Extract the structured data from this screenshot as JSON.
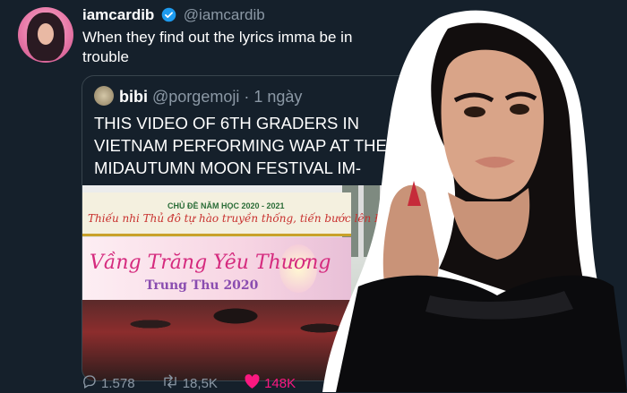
{
  "tweet": {
    "display_name": "iamcardib",
    "handle": "@iamcardib",
    "text": "When they find out the lyrics imma be in trouble"
  },
  "quoted_tweet": {
    "display_name": "bibi",
    "handle": "@porgemoji",
    "time": "· 1 ngày",
    "text": "THIS VIDEO OF 6TH GRADERS IN VIETNAM PERFORMING WAP AT THEIR MIDAUTUMN MOON FESTIVAL IM-"
  },
  "video_banner": {
    "topic": "CHỦ ĐỀ NĂM HỌC 2020 - 2021",
    "slogan": "Thiếu nhi Thủ đô tự hào truyền thống, tiến bước lên Đoàn",
    "title": "Vầng Trăng Yêu Thương",
    "subtitle": "Trung Thu 2020"
  },
  "actions": {
    "replies": "1.578",
    "retweets": "18,5K",
    "likes": "148K"
  },
  "colors": {
    "background": "#15202b",
    "like": "#f91880",
    "verified": "#1d9bf0"
  }
}
